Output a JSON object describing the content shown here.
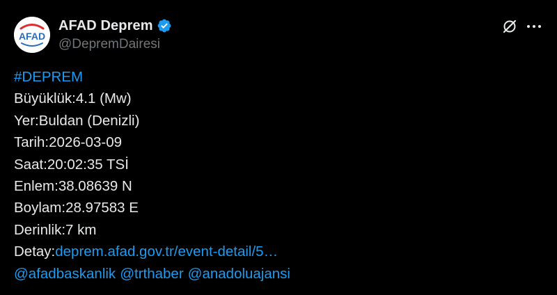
{
  "account": {
    "display_name": "AFAD Deprem",
    "handle": "@DepremDairesi",
    "avatar_text": "AFAD",
    "avatar_color": "#2b6cb8",
    "avatar_accent": "#e02d2d",
    "verified_color": "#1d9bf0",
    "verified_icon": "verified-badge-icon"
  },
  "actions": {
    "grok_icon": "grok-icon",
    "more_icon": "more-horizontal-icon"
  },
  "post": {
    "hashtag": "#DEPREM",
    "lines": [
      {
        "label": "Büyüklük:",
        "value": "4.1 (Mw)"
      },
      {
        "label": "Yer:",
        "value": "Buldan (Denizli)"
      },
      {
        "label": "Tarih:",
        "value": "2026-03-09"
      },
      {
        "label": "Saat:",
        "value": "20:02:35 TSİ"
      },
      {
        "label": "Enlem:",
        "value": "38.08639 N"
      },
      {
        "label": "Boylam:",
        "value": "28.97583 E"
      },
      {
        "label": "Derinlik:",
        "value": "7 km"
      }
    ],
    "detail_label": "Detay:",
    "detail_link": "deprem.afad.gov.tr/event-detail/5…",
    "mentions": [
      "@afadbaskanlik",
      "@trthaber",
      "@anadoluajansi"
    ]
  },
  "colors": {
    "background": "#000000",
    "text": "#e7e9ea",
    "secondary": "#71767b",
    "link": "#1d9bf0"
  }
}
